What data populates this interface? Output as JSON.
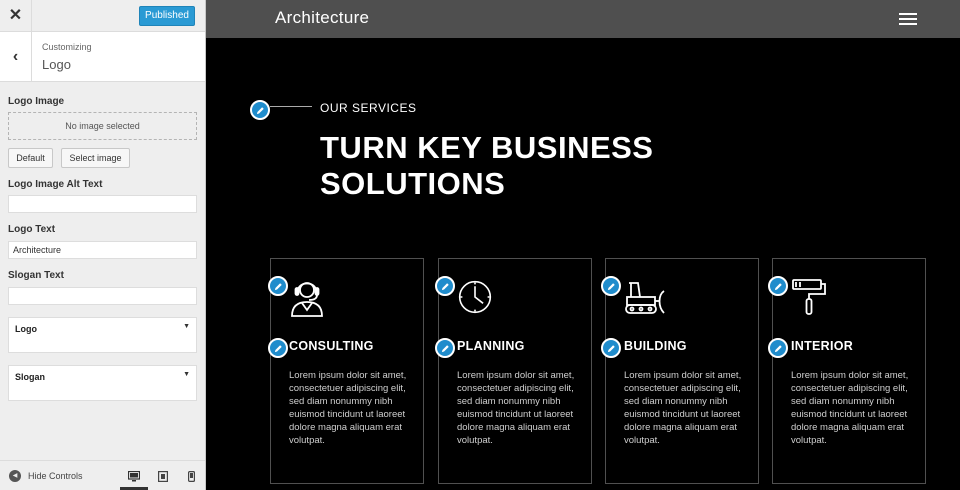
{
  "customizer": {
    "close_glyph": "✕",
    "publish_label": "Published",
    "back_glyph": "‹",
    "breadcrumb": "Customizing",
    "section_title": "Logo",
    "logo_image_label": "Logo Image",
    "no_image_text": "No image selected",
    "default_button": "Default",
    "select_image_button": "Select image",
    "alt_text_label": "Logo Image Alt Text",
    "alt_text_value": "",
    "logo_text_label": "Logo Text",
    "logo_text_value": "Architecture",
    "slogan_text_label": "Slogan Text",
    "slogan_text_value": "",
    "logo_select_label": "Logo",
    "slogan_select_label": "Slogan",
    "select_arrow": "▼",
    "hide_controls_label": "Hide Controls",
    "devices": [
      "desktop-icon",
      "tablet-icon",
      "mobile-icon"
    ],
    "active_device": "desktop"
  },
  "site": {
    "title": "Architecture",
    "services_kicker": "OUR SERVICES",
    "services_heading": "TURN KEY BUSINESS SOLUTIONS",
    "cards": [
      {
        "title": "CONSULTING",
        "icon": "headset-person-icon",
        "text": "Lorem ipsum dolor sit amet, consectetuer adipiscing elit, sed diam nonummy nibh euismod tincidunt ut laoreet dolore magna aliquam erat volutpat."
      },
      {
        "title": "PLANNING",
        "icon": "clock-icon",
        "text": "Lorem ipsum dolor sit amet, consectetuer adipiscing elit, sed diam nonummy nibh euismod tincidunt ut laoreet dolore magna aliquam erat volutpat."
      },
      {
        "title": "BUILDING",
        "icon": "bulldozer-icon",
        "text": "Lorem ipsum dolor sit amet, consectetuer adipiscing elit, sed diam nonummy nibh euismod tincidunt ut laoreet dolore magna aliquam erat volutpat."
      },
      {
        "title": "INTERIOR",
        "icon": "paint-roller-icon",
        "text": "Lorem ipsum dolor sit amet, consectetuer adipiscing elit, sed diam nonummy nibh euismod tincidunt ut laoreet dolore magna aliquam erat volutpat."
      }
    ]
  },
  "colors": {
    "publish_button": "#2a9ad4",
    "edit_shortcut": "#1f8ccc",
    "header_bar": "#4f4f4f",
    "page_background": "#000000"
  }
}
